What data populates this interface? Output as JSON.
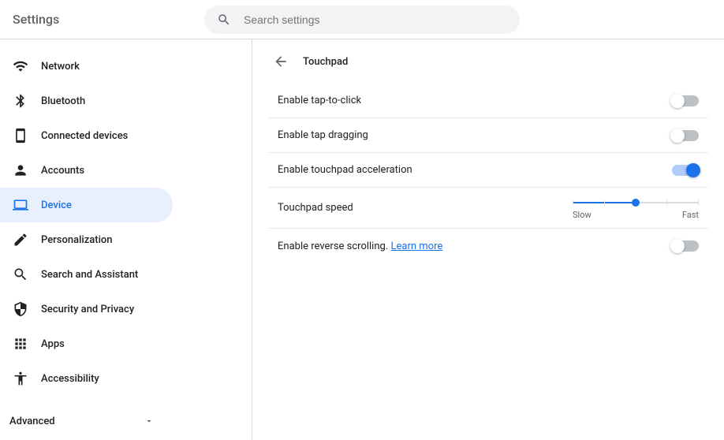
{
  "header": {
    "title": "Settings"
  },
  "search": {
    "placeholder": "Search settings"
  },
  "sidebar": {
    "items": [
      {
        "label": "Network"
      },
      {
        "label": "Bluetooth"
      },
      {
        "label": "Connected devices"
      },
      {
        "label": "Accounts"
      },
      {
        "label": "Device"
      },
      {
        "label": "Personalization"
      },
      {
        "label": "Search and Assistant"
      },
      {
        "label": "Security and Privacy"
      },
      {
        "label": "Apps"
      },
      {
        "label": "Accessibility"
      }
    ],
    "advanced": "Advanced"
  },
  "page": {
    "title": "Touchpad"
  },
  "settings": {
    "tap_to_click": {
      "label": "Enable tap-to-click",
      "on": false
    },
    "tap_dragging": {
      "label": "Enable tap dragging",
      "on": false
    },
    "acceleration": {
      "label": "Enable touchpad acceleration",
      "on": true
    },
    "speed": {
      "label": "Touchpad speed",
      "min": "Slow",
      "max": "Fast",
      "value": 3,
      "steps": 5
    },
    "reverse": {
      "label": "Enable reverse scrolling. ",
      "link": "Learn more",
      "on": false
    }
  }
}
